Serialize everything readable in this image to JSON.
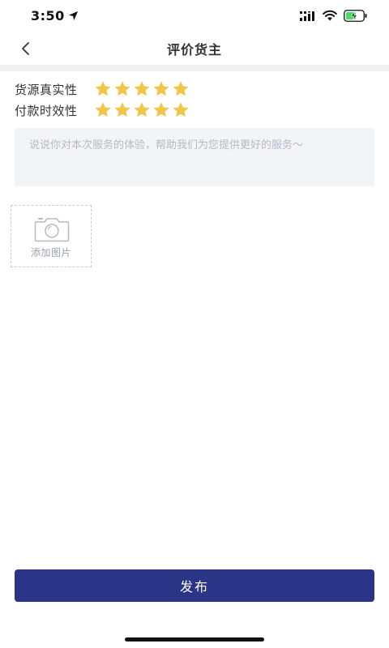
{
  "status_bar": {
    "time": "3:50",
    "icons": [
      "location-arrow-icon",
      "signal-icon",
      "wifi-icon",
      "battery-charging-icon"
    ],
    "battery_color": "#4cd964"
  },
  "nav": {
    "title": "评价货主",
    "back_icon": "chevron-left-icon"
  },
  "ratings": [
    {
      "label": "货源真实性",
      "stars": 5,
      "max": 5
    },
    {
      "label": "付款时效性",
      "stars": 5,
      "max": 5
    }
  ],
  "comment": {
    "value": "",
    "placeholder": "说说你对本次服务的体验，帮助我们为您提供更好的服务～"
  },
  "add_image": {
    "label": "添加图片",
    "icon": "camera-icon"
  },
  "publish": {
    "label": "发布"
  },
  "colors": {
    "accent": "#2b3587",
    "star": "#f0c548",
    "divider": "#f1f1f3",
    "input_bg": "#f3f4f8"
  }
}
